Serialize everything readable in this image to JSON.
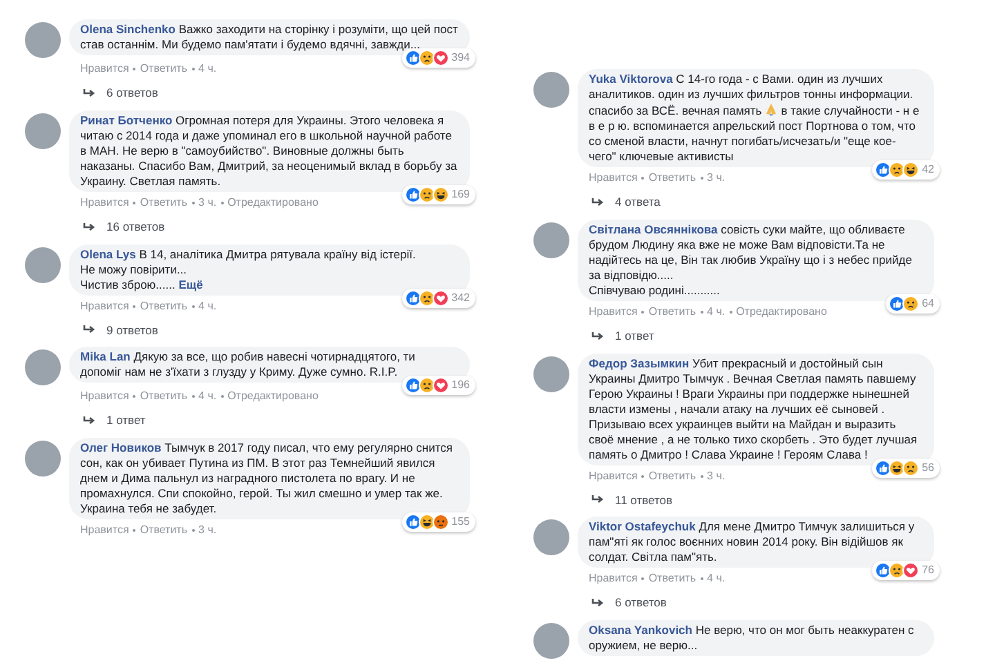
{
  "columns": [
    {
      "comments": [
        {
          "author": "Olena Sinchenko",
          "text": "Важко заходити на сторінку і розуміти, що цей пост став останнім. Ми будемо пам'ятати і будемо вдячні, завжди...",
          "actions": [
            "Нравится",
            "Ответить",
            "4 ч."
          ],
          "reactions": {
            "icons": [
              {
                "kind": "like"
              },
              {
                "kind": "sad"
              },
              {
                "kind": "love"
              }
            ],
            "count": "394"
          },
          "replies": "6 ответов"
        },
        {
          "author": "Ринат Ботченко",
          "text": "Огромная потеря для Украины. Этого человека я читаю с 2014 года и даже упоминал его в школьной научной работе в МАН. Не верю в \"самоубийство\". Виновные должны быть наказаны. Спасибо Вам, Дмитрий, за неоценимый вклад в борьбу за Украину. Светлая память.",
          "actions": [
            "Нравится",
            "Ответить",
            "3 ч.",
            "Отредактировано"
          ],
          "reactions": {
            "icons": [
              {
                "kind": "like"
              },
              {
                "kind": "sad"
              },
              {
                "kind": "haha"
              }
            ],
            "count": "169"
          },
          "replies": "16 ответов"
        },
        {
          "author": "Olena Lys",
          "text": "В 14, аналітика Дмитра рятувала країну від істерії.\nНе можу повірити...\nЧистив зброю......",
          "more": "Ещё",
          "actions": [
            "Нравится",
            "Ответить",
            "4 ч."
          ],
          "reactions": {
            "icons": [
              {
                "kind": "like"
              },
              {
                "kind": "sad"
              },
              {
                "kind": "love"
              }
            ],
            "count": "342"
          },
          "replies": "9 ответов"
        },
        {
          "author": "Mika Lan",
          "text": "Дякую за все, що робив навесні чотирнадцятого, ти допоміг нам не з'їхати з глузду у Криму. Дуже сумно. R.I.P.",
          "actions": [
            "Нравится",
            "Ответить",
            "4 ч.",
            "Отредактировано"
          ],
          "reactions": {
            "icons": [
              {
                "kind": "like"
              },
              {
                "kind": "sad"
              },
              {
                "kind": "love"
              }
            ],
            "count": "196"
          },
          "replies": "1 ответ"
        },
        {
          "author": "Олег Новиков",
          "text": "Тымчук в 2017 году писал, что ему регулярно снится сон, как он убивает Путина из ПМ. В этот раз Темнейший явился днем и Дима пальнул из наградного пистолета по врагу. И не промахнулся. Спи спокойно, герой. Ты жил смешно и умер так же. Украина тебя не забудет.",
          "actions": [
            "Нравится",
            "Ответить",
            "3 ч."
          ],
          "reactions": {
            "icons": [
              {
                "kind": "like"
              },
              {
                "kind": "haha"
              },
              {
                "kind": "angry"
              }
            ],
            "count": "155"
          }
        }
      ]
    },
    {
      "comments": [
        {
          "author": "Yuka Viktorova",
          "text": "С 14-го года - с Вами. один из лучших аналитиков. один из лучших фильтров тонны информации. спасибо за ВСЁ. вечная память",
          "emoji_after": "в такие случайности - н е в е р ю. вспоминается апрельский пост Портнова о том, что со сменой власти, начнут погибать/исчезать/и \"еще кое-чего\" ключевые активисты",
          "actions": [
            "Нравится",
            "Ответить",
            "3 ч."
          ],
          "reactions": {
            "icons": [
              {
                "kind": "like"
              },
              {
                "kind": "sad"
              },
              {
                "kind": "haha"
              }
            ],
            "count": "42"
          },
          "replies": "4 ответа"
        },
        {
          "author": "Світлана Овсяннікова",
          "text": "совість суки майте, що обливаєте брудом Людину яка вже не може Вам відповісти.Та не надійтесь на це, Він так любив Україну що і з небес прийде за відповідю.....\nСпівчуваю родині...........",
          "actions": [
            "Нравится",
            "Ответить",
            "4 ч.",
            "Отредактировано"
          ],
          "reactions": {
            "icons": [
              {
                "kind": "like"
              },
              {
                "kind": "sad"
              }
            ],
            "count": "64"
          },
          "replies": "1 ответ"
        },
        {
          "author": "Федор Зазымкин",
          "text": "Убит прекрасный и достойный сын Украины Дмитро Тымчук . Вечная Светлая память павшему Герою Украины ! Враги Украины при поддержке нынешней власти измены , начали атаку на лучших её сыновей . Призываю всех украинцев выйти на Майдан и выразить своё мнение , а не только тихо скорбеть . Это будет лучшая память о Дмитро ! Слава Украине ! Героям Слава !",
          "actions": [
            "Нравится",
            "Ответить",
            "3 ч."
          ],
          "reactions": {
            "icons": [
              {
                "kind": "like"
              },
              {
                "kind": "haha"
              },
              {
                "kind": "sad"
              }
            ],
            "count": "56"
          },
          "replies": "11 ответов"
        },
        {
          "author": "Viktor Ostafeychuk",
          "text": "Для мене Дмитро Тимчук залишиться у пам\"яті як голос воєнних новин 2014 року. Він відійшов як солдат. Світла пам\"ять.",
          "actions": [
            "Нравится",
            "Ответить",
            "4 ч."
          ],
          "reactions": {
            "icons": [
              {
                "kind": "like"
              },
              {
                "kind": "sad"
              },
              {
                "kind": "love"
              }
            ],
            "count": "76"
          },
          "replies": "6 ответов"
        },
        {
          "author": "Oksana Yankovich",
          "text": "Не верю, что он мог быть неаккуратен с оружием, не верю..."
        }
      ]
    }
  ]
}
